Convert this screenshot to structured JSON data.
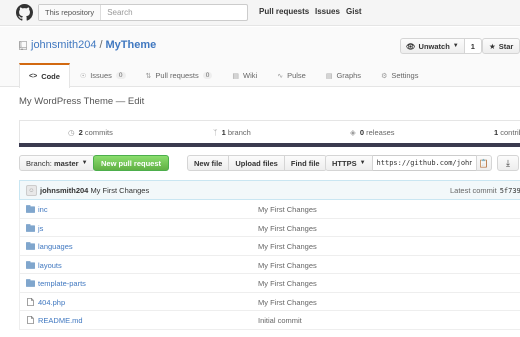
{
  "header": {
    "scope": "This repository",
    "search_placeholder": "Search",
    "nav": [
      "Pull requests",
      "Issues",
      "Gist"
    ]
  },
  "repo": {
    "owner": "johnsmith204",
    "separator": "/",
    "name": "MyTheme",
    "watch_label": "Unwatch",
    "watch_count": "1",
    "star_label": "Star"
  },
  "tabs": [
    {
      "label": "Code",
      "icon": "code-icon",
      "active": true
    },
    {
      "label": "Issues",
      "icon": "issue-icon",
      "badge": "0"
    },
    {
      "label": "Pull requests",
      "icon": "pull-request-icon",
      "badge": "0"
    },
    {
      "label": "Wiki",
      "icon": "book-icon"
    },
    {
      "label": "Pulse",
      "icon": "pulse-icon"
    },
    {
      "label": "Graphs",
      "icon": "graph-icon"
    },
    {
      "label": "Settings",
      "icon": "gear-icon"
    }
  ],
  "description": "My WordPress Theme — Edit",
  "summary": {
    "commits_num": "2",
    "commits_label": "commits",
    "branch_num": "1",
    "branch_label": "branch",
    "releases_num": "0",
    "releases_label": "releases",
    "contrib_num": "1",
    "contrib_label": "contrib"
  },
  "filenav": {
    "branch_prefix": "Branch:",
    "branch_name": "master",
    "new_pr": "New pull request",
    "new_file": "New file",
    "upload_files": "Upload files",
    "find_file": "Find file",
    "protocol": "HTTPS",
    "clone_url": "https://github.com/john"
  },
  "commit": {
    "author": "johnsmith204",
    "message": "My First Changes",
    "latest_label": "Latest commit",
    "sha": "5f739"
  },
  "files": [
    {
      "name": "inc",
      "type": "dir",
      "message": "My First Changes"
    },
    {
      "name": "js",
      "type": "dir",
      "message": "My First Changes"
    },
    {
      "name": "languages",
      "type": "dir",
      "message": "My First Changes"
    },
    {
      "name": "layouts",
      "type": "dir",
      "message": "My First Changes"
    },
    {
      "name": "template-parts",
      "type": "dir",
      "message": "My First Changes"
    },
    {
      "name": "404.php",
      "type": "file",
      "message": "My First Changes"
    },
    {
      "name": "README.md",
      "type": "file",
      "message": "Initial commit"
    }
  ],
  "colors": {
    "link": "#4078c0",
    "tab_accent": "#d26911",
    "new_pr_green": "#60b044",
    "commit_bar_bg": "#f2f8fa",
    "folder_icon": "#80a6cd"
  }
}
